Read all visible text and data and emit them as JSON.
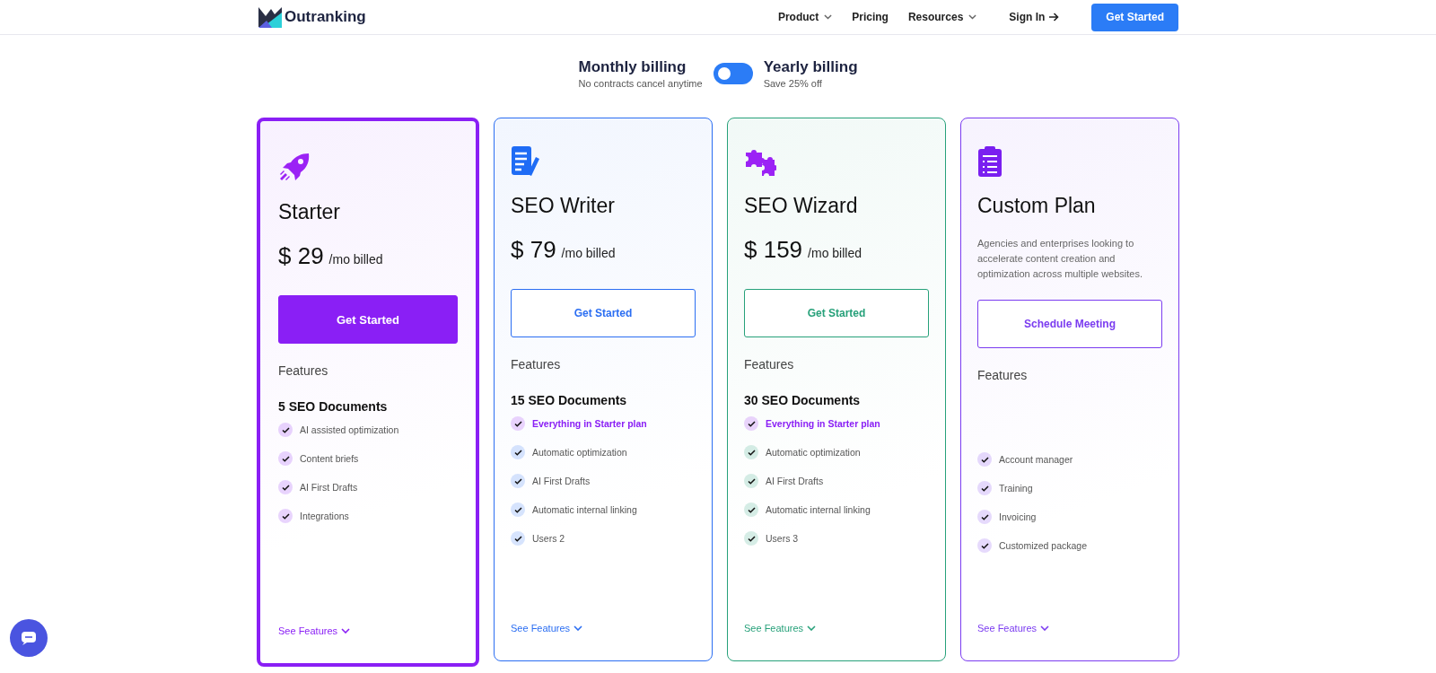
{
  "header": {
    "brand": "Outranking",
    "nav": [
      {
        "label": "Product",
        "dropdown": true
      },
      {
        "label": "Pricing",
        "dropdown": false
      },
      {
        "label": "Resources",
        "dropdown": true
      }
    ],
    "sign_in": "Sign In",
    "cta": "Get Started"
  },
  "billing": {
    "monthly": {
      "title": "Monthly billing",
      "subtitle": "No contracts cancel anytime"
    },
    "yearly": {
      "title": "Yearly billing",
      "subtitle": "Save 25% off"
    },
    "on": false
  },
  "plans": [
    {
      "kind": "rocket",
      "name": "Starter",
      "selected": true,
      "color": "#8a1ff5",
      "price": "$ 29",
      "period": "/mo billed",
      "button": "Get Started",
      "features_label": "Features",
      "documents": "5 SEO Documents",
      "features": [
        {
          "label": "AI assisted optimization",
          "highlight": false
        },
        {
          "label": "Content briefs",
          "highlight": false
        },
        {
          "label": "AI First Drafts",
          "highlight": false
        },
        {
          "label": "Integrations",
          "highlight": false
        }
      ],
      "see_features": "See Features"
    },
    {
      "kind": "document",
      "name": "SEO Writer",
      "selected": false,
      "color": "#2b6ef2",
      "price": "$ 79",
      "period": "/mo billed",
      "button": "Get Started",
      "features_label": "Features",
      "documents": "15 SEO Documents",
      "features": [
        {
          "label": "Everything in Starter plan",
          "highlight": true
        },
        {
          "label": "Automatic optimization",
          "highlight": false
        },
        {
          "label": "AI First Drafts",
          "highlight": false
        },
        {
          "label": "Automatic internal linking",
          "highlight": false
        },
        {
          "label": "Users 2",
          "highlight": false
        }
      ],
      "see_features": "See Features"
    },
    {
      "kind": "puzzle",
      "name": "SEO Wizard",
      "selected": false,
      "color": "#27a17a",
      "price": "$ 159",
      "period": "/mo billed",
      "button": "Get Started",
      "features_label": "Features",
      "documents": "30 SEO Documents",
      "features": [
        {
          "label": "Everything in Starter plan",
          "highlight": true
        },
        {
          "label": "Automatic optimization",
          "highlight": false
        },
        {
          "label": "AI First Drafts",
          "highlight": false
        },
        {
          "label": "Automatic internal linking",
          "highlight": false
        },
        {
          "label": "Users 3",
          "highlight": false
        }
      ],
      "see_features": "See Features"
    },
    {
      "kind": "clipboard",
      "name": "Custom Plan",
      "selected": false,
      "color": "#7b3cf0",
      "description": "Agencies and enterprises looking to accelerate content creation and optimization across multiple websites.",
      "button": "Schedule Meeting",
      "features_label": "Features",
      "features": [
        {
          "label": "Account manager",
          "highlight": false
        },
        {
          "label": "Training",
          "highlight": false
        },
        {
          "label": "Invoicing",
          "highlight": false
        },
        {
          "label": "Customized package",
          "highlight": false
        }
      ],
      "see_features": "See Features"
    }
  ]
}
